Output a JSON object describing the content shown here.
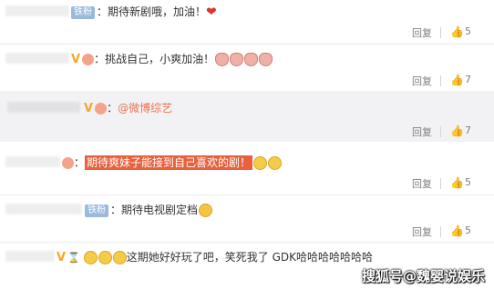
{
  "actions": {
    "reply_label": "回复"
  },
  "comments": [
    {
      "badge": "铁粉",
      "text": "：期待新剧哦，加油！",
      "likes": "5"
    },
    {
      "text": "：挑战自己，小爽加油！",
      "likes": "7"
    },
    {
      "link": "@微博综艺",
      "likes": "7",
      "nested": true
    },
    {
      "highlight": "期待爽妹子能接到自己喜欢的剧！",
      "likes": "5"
    },
    {
      "badge": "铁粉",
      "text": "：期待电视剧定档",
      "likes": "5"
    },
    {
      "text": "这期她好好玩了吧，笑死我了 GDK哈哈哈哈哈哈哈",
      "likes": ""
    }
  ],
  "watermark": "搜狐号@魏婴说娱乐"
}
